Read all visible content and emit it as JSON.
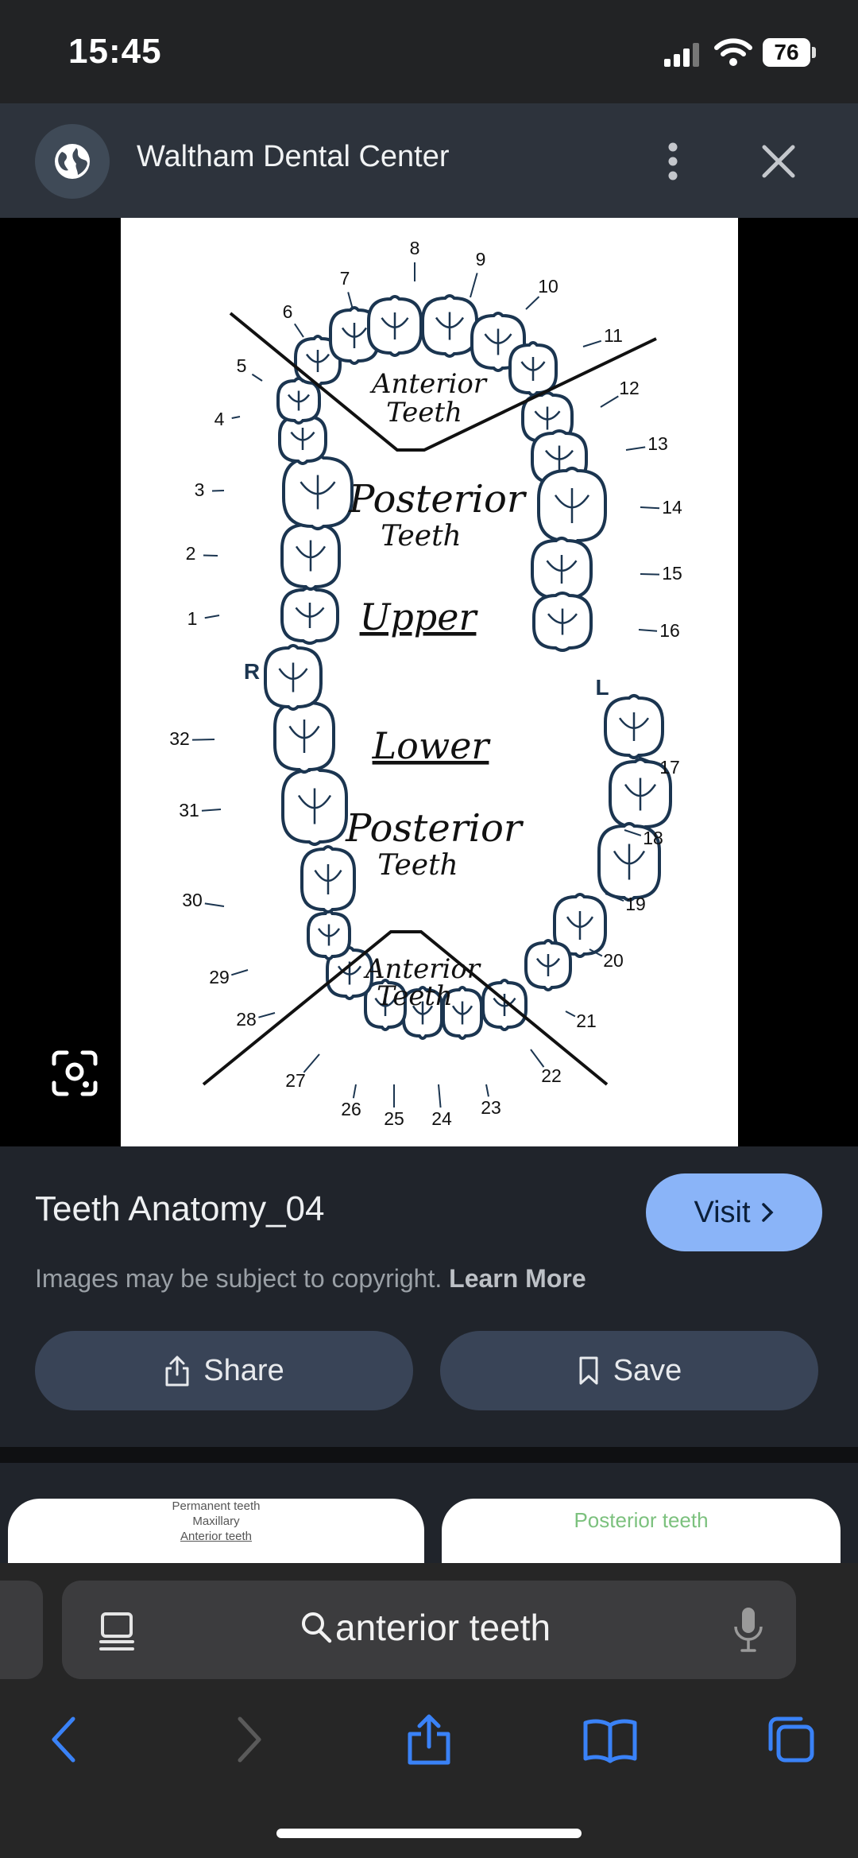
{
  "status_bar": {
    "time": "15:45",
    "battery": "76"
  },
  "header": {
    "site_name": "Waltham Dental Center"
  },
  "image": {
    "numbers_upper": [
      "1",
      "2",
      "3",
      "4",
      "5",
      "6",
      "7",
      "8",
      "9",
      "10",
      "11",
      "12",
      "13",
      "14",
      "15",
      "16"
    ],
    "numbers_lower": [
      "17",
      "18",
      "19",
      "20",
      "21",
      "22",
      "23",
      "24",
      "25",
      "26",
      "27",
      "28",
      "29",
      "30",
      "31",
      "32"
    ],
    "side_right": "R",
    "side_left": "L",
    "label_anterior_upper": [
      "Anterior",
      "Teeth"
    ],
    "label_posterior_upper": [
      "Posterior",
      "Teeth"
    ],
    "label_upper": "Upper",
    "label_lower": "Lower",
    "label_posterior_lower": [
      "Posterior",
      "Teeth"
    ],
    "label_anterior_lower": [
      "Anterior",
      "Teeth"
    ]
  },
  "info": {
    "title": "Teeth Anatomy_04",
    "visit_label": "Visit",
    "copyright": "Images may be subject to copyright.",
    "learn_more": "Learn More",
    "share_label": "Share",
    "save_label": "Save"
  },
  "related": {
    "thumb1_lines": [
      "Permanent teeth",
      "Maxillary",
      "Anterior teeth"
    ],
    "thumb2_title": "Posterior teeth"
  },
  "address_bar": {
    "query": "anterior teeth"
  },
  "icons": [
    "globe-icon",
    "more-vert-icon",
    "close-icon",
    "lens-icon",
    "chevron-right-icon",
    "share-icon",
    "bookmark-icon",
    "reader-icon",
    "search-icon",
    "mic-icon",
    "back-icon",
    "forward-icon",
    "share-nav-icon",
    "bookmarks-icon",
    "tabs-icon"
  ],
  "colors": {
    "accent": "#8ab4f8",
    "safari_blue": "#3a82f7"
  }
}
